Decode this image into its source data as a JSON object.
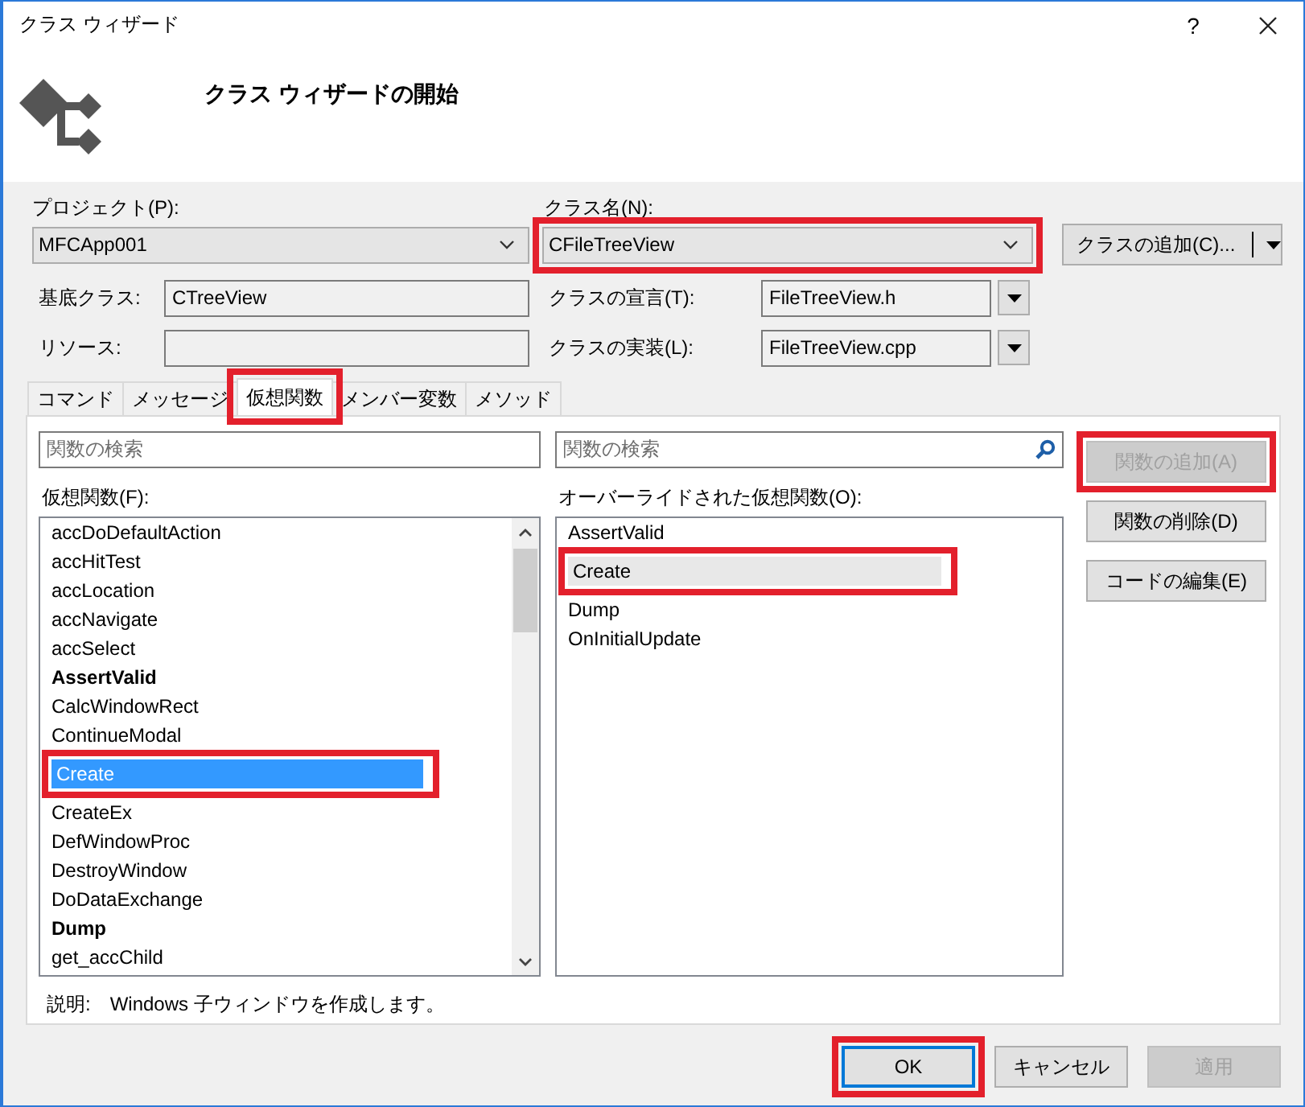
{
  "window": {
    "title": "クラス ウィザード",
    "help": "?"
  },
  "header": {
    "title": "クラス ウィザードの開始"
  },
  "project": {
    "label": "プロジェクト(P):",
    "value": "MFCApp001",
    "highlighted": false
  },
  "class_name": {
    "label": "クラス名(N):",
    "value": "CFileTreeView",
    "highlighted": true
  },
  "add_class_button": {
    "label": "クラスの追加(C)...",
    "highlighted": false
  },
  "base_class": {
    "label": "基底クラス:",
    "value": "CTreeView"
  },
  "resource": {
    "label": "リソース:"
  },
  "declaration": {
    "label": "クラスの宣言(T):",
    "value": "FileTreeView.h"
  },
  "implementation": {
    "label": "クラスの実装(L):",
    "value": "FileTreeView.cpp"
  },
  "tabs": [
    {
      "label": "コマンド",
      "selected": false,
      "highlighted": false
    },
    {
      "label": "メッセージ",
      "selected": false,
      "highlighted": false
    },
    {
      "label": "仮想関数",
      "selected": true,
      "highlighted": true
    },
    {
      "label": "メンバー変数",
      "selected": false,
      "highlighted": false
    },
    {
      "label": "メソッド",
      "selected": false,
      "highlighted": false
    }
  ],
  "virtual_functions": {
    "search": {
      "placeholder": "関数の検索"
    },
    "label": "仮想関数(F):",
    "items": [
      {
        "name": "accDoDefaultAction",
        "overridden": false,
        "selected": false,
        "highlighted": false
      },
      {
        "name": "accHitTest",
        "overridden": false,
        "selected": false,
        "highlighted": false
      },
      {
        "name": "accLocation",
        "overridden": false,
        "selected": false,
        "highlighted": false
      },
      {
        "name": "accNavigate",
        "overridden": false,
        "selected": false,
        "highlighted": false
      },
      {
        "name": "accSelect",
        "overridden": false,
        "selected": false,
        "highlighted": false
      },
      {
        "name": "AssertValid",
        "overridden": true,
        "selected": false,
        "highlighted": false
      },
      {
        "name": "CalcWindowRect",
        "overridden": false,
        "selected": false,
        "highlighted": false
      },
      {
        "name": "ContinueModal",
        "overridden": false,
        "selected": false,
        "highlighted": false
      },
      {
        "name": "Create",
        "overridden": false,
        "selected": true,
        "highlighted": true
      },
      {
        "name": "CreateEx",
        "overridden": false,
        "selected": false,
        "highlighted": false
      },
      {
        "name": "DefWindowProc",
        "overridden": false,
        "selected": false,
        "highlighted": false
      },
      {
        "name": "DestroyWindow",
        "overridden": false,
        "selected": false,
        "highlighted": false
      },
      {
        "name": "DoDataExchange",
        "overridden": false,
        "selected": false,
        "highlighted": false
      },
      {
        "name": "Dump",
        "overridden": true,
        "selected": false,
        "highlighted": false
      },
      {
        "name": "get_accChild",
        "overridden": false,
        "selected": false,
        "highlighted": false
      }
    ]
  },
  "overridden_functions": {
    "search": {
      "placeholder": "関数の検索"
    },
    "label": "オーバーライドされた仮想関数(O):",
    "items": [
      {
        "name": "AssertValid",
        "selected": false,
        "highlighted": false
      },
      {
        "name": "Create",
        "selected": true,
        "highlighted": true
      },
      {
        "name": "Dump",
        "selected": false,
        "highlighted": false
      },
      {
        "name": "OnInitialUpdate",
        "selected": false,
        "highlighted": false
      }
    ]
  },
  "side_buttons": [
    {
      "label": "関数の追加(A)",
      "disabled": true,
      "highlighted": true
    },
    {
      "label": "関数の削除(D)",
      "disabled": false,
      "highlighted": false
    },
    {
      "label": "コードの編集(E)",
      "disabled": false,
      "highlighted": false
    }
  ],
  "description": {
    "label": "説明:",
    "text": "Windows 子ウィンドウを作成します。"
  },
  "footer_buttons": [
    {
      "label": "OK",
      "default": true,
      "disabled": false,
      "highlighted": true
    },
    {
      "label": "キャンセル",
      "default": false,
      "disabled": false,
      "highlighted": false
    },
    {
      "label": "適用",
      "default": false,
      "disabled": true,
      "highlighted": false
    }
  ]
}
